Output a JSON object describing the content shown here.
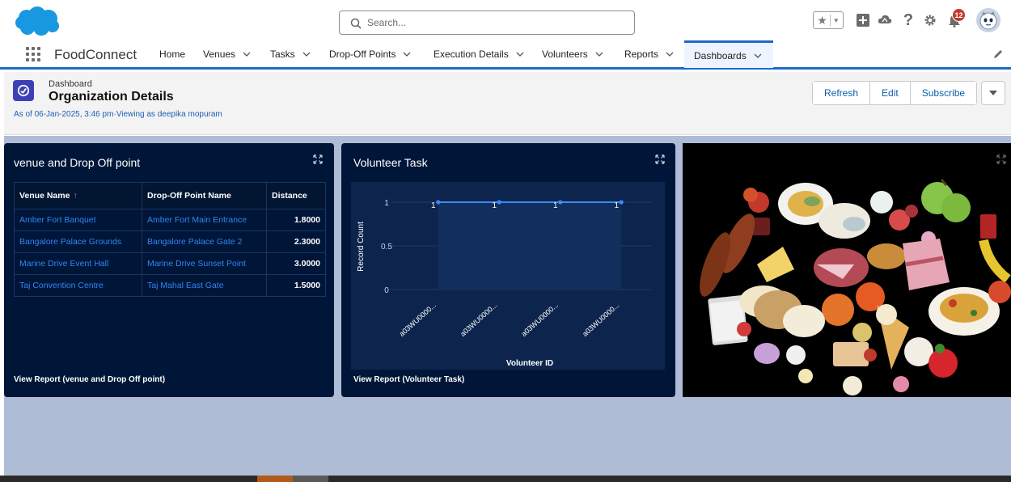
{
  "header": {
    "search_placeholder": "Search...",
    "notification_count": "12"
  },
  "nav": {
    "app_name": "FoodConnect",
    "items": [
      {
        "label": "Home"
      },
      {
        "label": "Venues"
      },
      {
        "label": "Tasks"
      },
      {
        "label": "Drop-Off Points"
      },
      {
        "label": "Execution Details"
      },
      {
        "label": "Volunteers"
      },
      {
        "label": "Reports"
      },
      {
        "label": "Dashboards"
      }
    ]
  },
  "dashboard": {
    "kind": "Dashboard",
    "title": "Organization Details",
    "as_of": "As of 06-Jan-2025, 3:46 pm·Viewing as deepika mopuram",
    "buttons": {
      "refresh": "Refresh",
      "edit": "Edit",
      "subscribe": "Subscribe"
    }
  },
  "widget1": {
    "title": "venue and Drop Off point",
    "columns": [
      "Venue Name",
      "Drop-Off Point Name",
      "Distance"
    ],
    "sort_indicator": "↑",
    "rows": [
      {
        "venue": "Amber Fort Banquet",
        "dropoff": "Amber Fort Main Entrance",
        "distance": "1.8000"
      },
      {
        "venue": "Bangalore Palace Grounds",
        "dropoff": "Bangalore Palace Gate 2",
        "distance": "2.3000"
      },
      {
        "venue": "Marine Drive Event Hall",
        "dropoff": "Marine Drive Sunset Point",
        "distance": "3.0000"
      },
      {
        "venue": "Taj Convention Centre",
        "dropoff": "Taj Mahal East Gate",
        "distance": "1.5000"
      }
    ],
    "footer": "View Report (venue and Drop Off point)"
  },
  "widget2": {
    "title": "Volunteer Task",
    "footer": "View Report (Volunteer Task)"
  },
  "chart_data": {
    "type": "line",
    "categories": [
      "a03WU0000...",
      "a03WU0000...",
      "a03WU0000...",
      "a03WU0000..."
    ],
    "values": [
      1,
      1,
      1,
      1
    ],
    "data_labels": [
      "1",
      "1",
      "1",
      "1"
    ],
    "xlabel": "Volunteer ID",
    "ylabel": "Record Count",
    "yticks": [
      "0",
      "0.5",
      "1"
    ],
    "ylim": [
      0,
      1
    ],
    "line_color": "#3a8bf5",
    "area_color": "#12305f"
  },
  "colors": {
    "brand": "#1b6ac9",
    "widget_bg": "#001639",
    "link": "#2f86f0",
    "canvas": "#aebcd6"
  }
}
